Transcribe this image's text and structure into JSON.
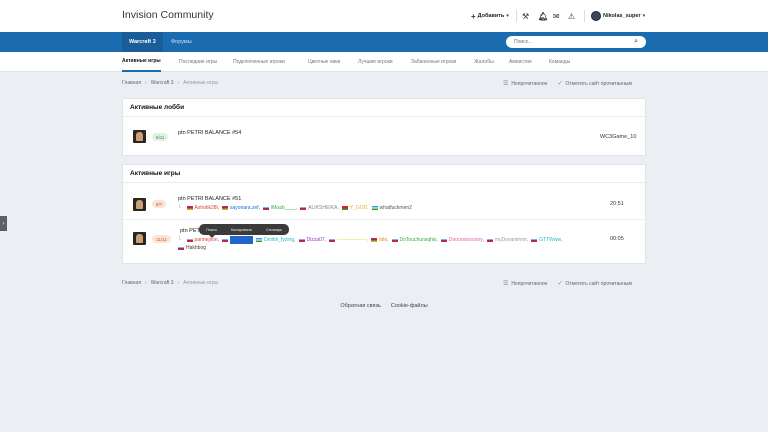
{
  "app": {
    "title": "Invision Community"
  },
  "topbar": {
    "add_label": "Добавить",
    "user_name": "Nikolas_super"
  },
  "nav": {
    "items": [
      "Warcraft 3",
      "Форумы"
    ],
    "search_placeholder": "Поиск..."
  },
  "subnav": {
    "items": [
      "Активные игры",
      "Последние игры",
      "Подключенные игроки",
      "Цветные ники",
      "Лучшие игроки",
      "Забаненные игроки",
      "Жалобы",
      "Амнистии",
      "Команды"
    ]
  },
  "breadcrumb": {
    "items": [
      "Главная",
      "Warcraft 3",
      "Активные игры"
    ]
  },
  "page_actions": {
    "unread": "Непрочитанное",
    "mark_read": "Отметить сайт прочитанным"
  },
  "lobbies": {
    "heading": "Активные лобби",
    "rows": [
      {
        "slots": "6/11",
        "title": "ptn PETRI BALANCE #54",
        "host": "WC3Game_10"
      }
    ]
  },
  "games": {
    "heading": "Активные игры",
    "rows": [
      {
        "slots": "8/7",
        "title": "ptn PETRI BALANCE #51",
        "time": "20:51",
        "players": [
          {
            "name": "Ashotik28l,",
            "color": "#d8403c",
            "flag": "am"
          },
          {
            "name": "sayonara.zef,",
            "color": "#1b6bd8",
            "flag": "am"
          },
          {
            "name": "iMoah____,",
            "color": "#3aa83a",
            "flag": "ru"
          },
          {
            "name": "ALIKSHEIKA,",
            "color": "#888888",
            "flag": "ru"
          },
          {
            "name": "Y_GOD,",
            "color": "#d8b020",
            "flag": "by"
          },
          {
            "name": "whatfuckmen2",
            "color": "#555555",
            "flag": "uz"
          }
        ]
      },
      {
        "slots": "11/11",
        "title": "ptn PETRI",
        "time": "00:05",
        "players": [
          {
            "name": "pannejson,",
            "color": "#d8403c",
            "flag": "ru"
          },
          {
            "name": "Tanya_RS",
            "color": "#1b6bd8",
            "flag": "ru",
            "selected": true
          },
          {
            "name": "Dmitrii_fyzing,",
            "color": "#20b8c0",
            "flag": "uz"
          },
          {
            "name": "Dizza07,",
            "color": "#8a3ac8",
            "flag": "ru"
          },
          {
            "name": "——————,",
            "color": "#e8d020",
            "flag": "ru"
          },
          {
            "name": "lolo,",
            "color": "#e07a1a",
            "flag": "am"
          },
          {
            "name": "DoTouchunsqhis,",
            "color": "#3aa83a",
            "flag": "ru"
          },
          {
            "name": "Dooooooooooy,",
            "color": "#e060a8",
            "flag": "ru"
          },
          {
            "name": "myDovanimmr,",
            "color": "#999999",
            "flag": "ru"
          },
          {
            "name": "GTTWww,",
            "color": "#2ab8c0",
            "flag": "ru"
          },
          {
            "name": "Hakhbog",
            "color": "#5a3a1a",
            "flag": "ru"
          }
        ]
      }
    ]
  },
  "context_tooltip": {
    "items": [
      "Поиск",
      "Копировать",
      "Словарь"
    ]
  },
  "footer": {
    "links": [
      "Обратная связь",
      "Cookie-файлы"
    ]
  }
}
